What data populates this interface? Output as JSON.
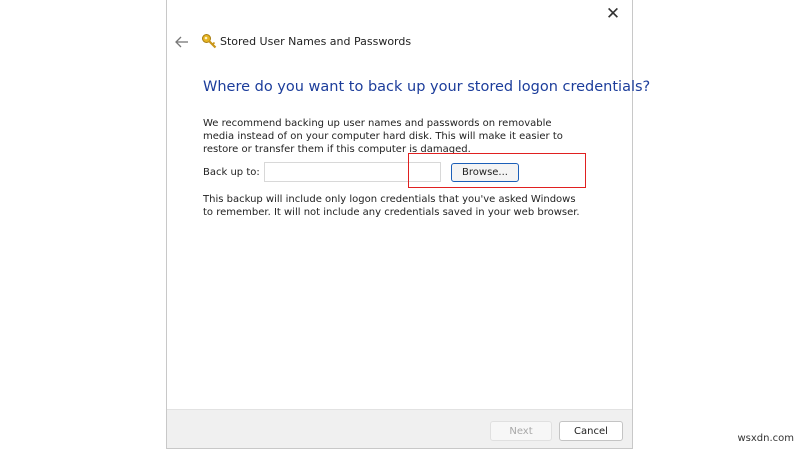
{
  "window": {
    "title": "Stored User Names and Passwords",
    "close_glyph": "✕",
    "icons": {
      "close": "close-icon",
      "back": "arrow-left-icon",
      "title": "key-icon"
    }
  },
  "main": {
    "heading": "Where do you want to back up your stored logon credentials?",
    "recommendation": "We recommend backing up user names and passwords on removable media instead of on your computer hard disk. This will make it easier to restore or transfer them if this computer is damaged.",
    "backup_label": "Back up to:",
    "backup_value": "",
    "browse_label": "Browse...",
    "note": "This backup will include only logon credentials that you've asked Windows to remember. It will not include any credentials saved in your web browser."
  },
  "footer": {
    "next_label": "Next",
    "cancel_label": "Cancel"
  },
  "annotation": {
    "highlight_color": "#e02020"
  },
  "watermark": "wsxdn.com",
  "colors": {
    "heading": "#1c3d9b",
    "accent": "#1c5fb8",
    "footer_bg": "#f0f0f0"
  }
}
